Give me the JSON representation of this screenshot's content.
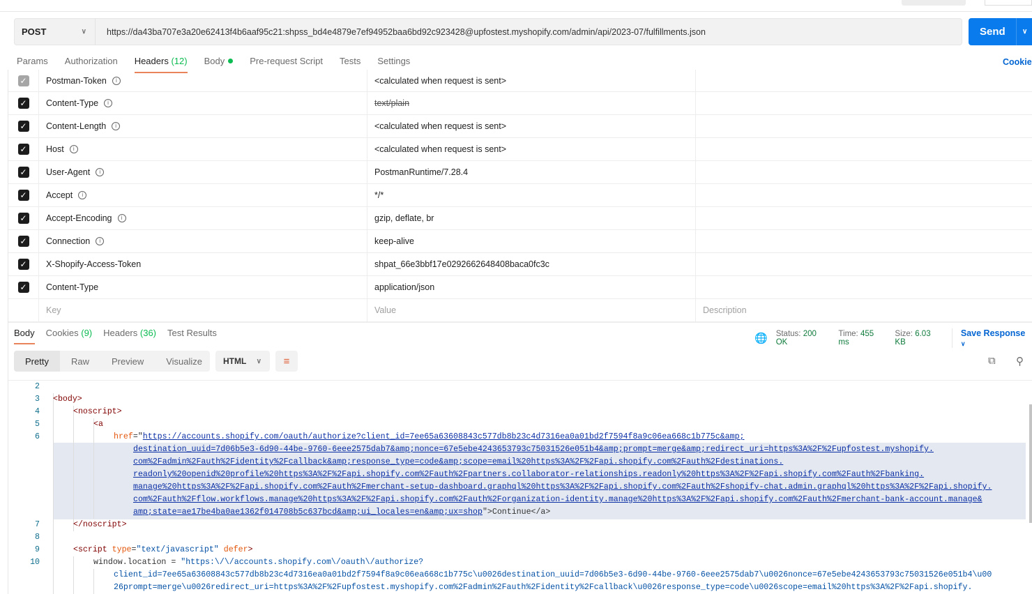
{
  "request": {
    "method": "POST",
    "url": "https://da43ba707e3a20e62413f4b6aaf95c21: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@upfostest.myshopify.com/admin/api/2023-07/fulfillments.json",
    "send_label": "Send"
  },
  "req_tabs": {
    "params": "Params",
    "authorization": "Authorization",
    "headers": "Headers",
    "headers_count": "(12)",
    "body": "Body",
    "prerequest": "Pre-request Script",
    "tests": "Tests",
    "settings": "Settings",
    "cookies": "Cookies"
  },
  "headers": [
    {
      "key": "Postman-Token",
      "value": "<calculated when request is sent>",
      "info": true,
      "disabled": true
    },
    {
      "key": "Content-Type",
      "value": "text/plain",
      "info": true,
      "struck": true
    },
    {
      "key": "Content-Length",
      "value": "<calculated when request is sent>",
      "info": true
    },
    {
      "key": "Host",
      "value": "<calculated when request is sent>",
      "info": true
    },
    {
      "key": "User-Agent",
      "value": "PostmanRuntime/7.28.4",
      "info": true
    },
    {
      "key": "Accept",
      "value": "*/*",
      "info": true
    },
    {
      "key": "Accept-Encoding",
      "value": "gzip, deflate, br",
      "info": true
    },
    {
      "key": "Connection",
      "value": "keep-alive",
      "info": true
    },
    {
      "key": "X-Shopify-Access-Token",
      "value": "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"
    },
    {
      "key": "Content-Type",
      "value": "application/json"
    }
  ],
  "headers_placeholder": {
    "key": "Key",
    "value": "Value",
    "description": "Description"
  },
  "response": {
    "tabs": {
      "body": "Body",
      "cookies": "Cookies",
      "cookies_count": "(9)",
      "headers": "Headers",
      "headers_count": "(36)",
      "tests": "Test Results"
    },
    "status_label": "Status:",
    "status": "200 OK",
    "time_label": "Time:",
    "time": "455 ms",
    "size_label": "Size:",
    "size": "6.03 KB",
    "save": "Save Response",
    "modes": [
      "Pretty",
      "Raw",
      "Preview",
      "Visualize"
    ],
    "format": "HTML",
    "line_numbers": [
      "2",
      "3",
      "4",
      "5",
      "6",
      "7",
      "8",
      "9",
      "10"
    ],
    "code": {
      "l3": "<body>",
      "l4": "<noscript>",
      "l5": "<a",
      "href_attr": "href",
      "l6_url": [
        "https://accounts.shopify.com/oauth/authorize?client_id=7ee65a63608843c577db8b23c4d7316ea0a01bd2f7594f8a9c06ea668c1b775c&amp;",
        "destination_uuid=7d06b5e3-6d90-44be-9760-6eee2575dab7&amp;nonce=67e5ebe4243653793c75031526e051b4&amp;prompt=merge&amp;redirect_uri=https%3A%2F%2Fupfostest.myshopify.",
        "com%2Fadmin%2Fauth%2Fidentity%2Fcallback&amp;response_type=code&amp;scope=email%20https%3A%2F%2Fapi.shopify.com%2Fauth%2Fdestinations.",
        "readonly%20openid%20profile%20https%3A%2F%2Fapi.shopify.com%2Fauth%2Fpartners.collaborator-relationships.readonly%20https%3A%2F%2Fapi.shopify.com%2Fauth%2Fbanking.",
        "manage%20https%3A%2F%2Fapi.shopify.com%2Fauth%2Fmerchant-setup-dashboard.graphql%20https%3A%2F%2Fapi.shopify.com%2Fauth%2Fshopify-chat.admin.graphql%20https%3A%2F%2Fapi.shopify.",
        "com%2Fauth%2Fflow.workflows.manage%20https%3A%2F%2Fapi.shopify.com%2Fauth%2Forganization-identity.manage%20https%3A%2F%2Fapi.shopify.com%2Fauth%2Fmerchant-bank-account.manage&",
        "amp;state=ae17be4ba0ae1362f014708b5c637bcd&amp;ui_locales=en&amp;ux=shop"
      ],
      "l6_tail": ">Continue</a>",
      "l7": "</noscript>",
      "l9_tag": "<script",
      "l9_attr": "type",
      "l9_val": "\"text/javascript\"",
      "l9_defer": "defer",
      "l9_end": ">",
      "l10_a": "window.location = ",
      "l10_b": "\"https:\\/\\/accounts.shopify.com\\/oauth\\/authorize?",
      "l10_c": "client_id=7ee65a63608843c577db8b23c4d7316ea0a01bd2f7594f8a9c06ea668c1b775c\\u0026destination_uuid=7d06b5e3-6d90-44be-9760-6eee2575dab7\\u0026nonce=67e5ebe4243653793c75031526e051b4\\u00",
      "l10_d": "26prompt=merge\\u0026redirect_uri=https%3A%2F%2Fupfostest.myshopify.com%2Fadmin%2Fauth%2Fidentity%2Fcallback\\u0026response_type=code\\u0026scope=email%20https%3A%2F%2Fapi.shopify."
    }
  }
}
